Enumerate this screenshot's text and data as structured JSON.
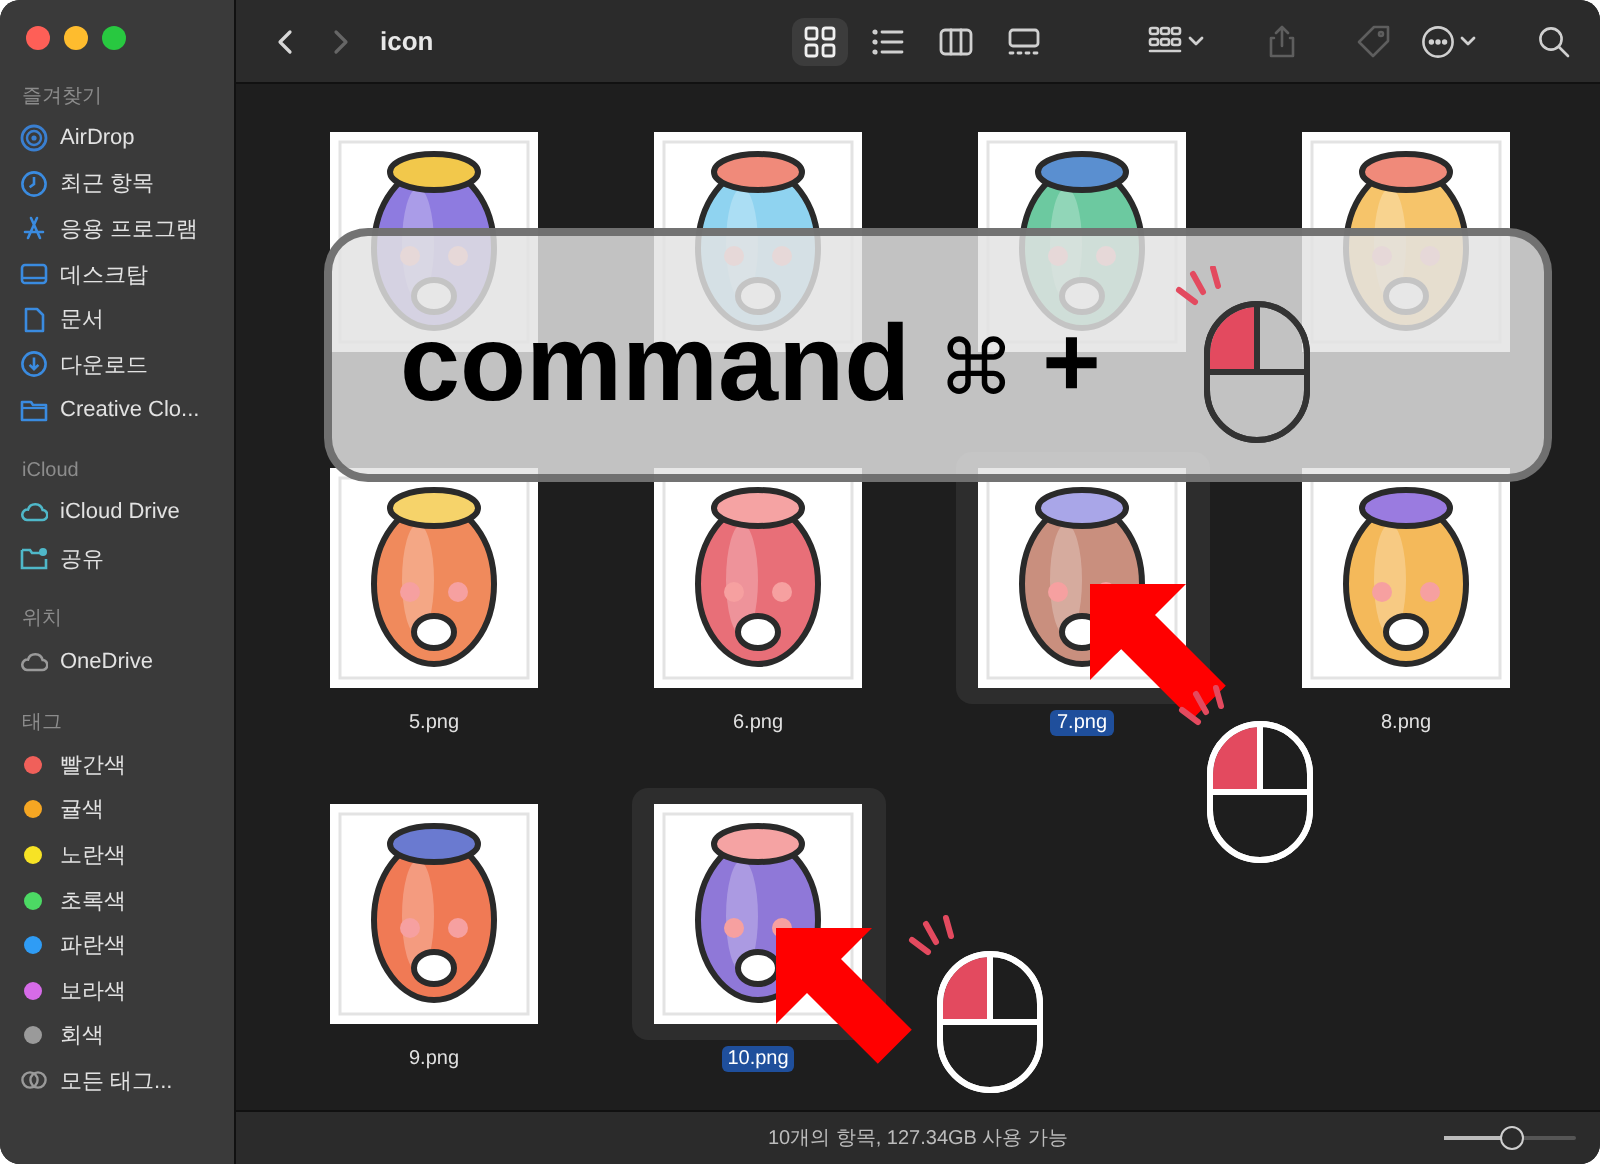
{
  "window": {
    "title": "icon"
  },
  "toolbar": {
    "nav": [
      {
        "kind": "back",
        "disabled": false
      },
      {
        "kind": "forward",
        "disabled": true
      }
    ],
    "view_modes": [
      {
        "kind": "icons",
        "selected": true
      },
      {
        "kind": "list",
        "selected": false
      },
      {
        "kind": "columns",
        "selected": false
      },
      {
        "kind": "gallery",
        "selected": false
      }
    ],
    "actions": [
      {
        "kind": "group",
        "disabled": false
      },
      {
        "kind": "share",
        "disabled": true
      },
      {
        "kind": "tag",
        "disabled": true
      },
      {
        "kind": "more",
        "disabled": false
      },
      {
        "kind": "search",
        "disabled": false
      }
    ]
  },
  "sidebar": {
    "sections": [
      {
        "title": "즐겨찾기",
        "items": [
          {
            "label": "AirDrop",
            "kind": "airdrop"
          },
          {
            "label": "최근 항목",
            "kind": "recents"
          },
          {
            "label": "응용 프로그램",
            "kind": "applications"
          },
          {
            "label": "데스크탑",
            "kind": "desktop"
          },
          {
            "label": "문서",
            "kind": "documents"
          },
          {
            "label": "다운로드",
            "kind": "downloads"
          },
          {
            "label": "Creative Clo...",
            "kind": "folder"
          }
        ]
      },
      {
        "title": "iCloud",
        "items": [
          {
            "label": "iCloud Drive",
            "kind": "icloud"
          },
          {
            "label": "공유",
            "kind": "shared"
          }
        ]
      },
      {
        "title": "위치",
        "items": [
          {
            "label": "OneDrive",
            "kind": "cloud"
          }
        ]
      },
      {
        "title": "태그",
        "items": [
          {
            "label": "빨간색",
            "kind": "tag",
            "color": "#f0605a"
          },
          {
            "label": "귤색",
            "kind": "tag",
            "color": "#f5a623"
          },
          {
            "label": "노란색",
            "kind": "tag",
            "color": "#f7e325"
          },
          {
            "label": "초록색",
            "kind": "tag",
            "color": "#4cd964"
          },
          {
            "label": "파란색",
            "kind": "tag",
            "color": "#2f9cf5"
          },
          {
            "label": "보라색",
            "kind": "tag",
            "color": "#d66be8"
          },
          {
            "label": "회색",
            "kind": "tag",
            "color": "#9a9a9a"
          },
          {
            "label": "모든 태그...",
            "kind": "all_tags"
          }
        ]
      }
    ]
  },
  "files": [
    {
      "selected": false
    },
    {
      "selected": false
    },
    {
      "selected": false
    },
    {
      "selected": false
    },
    {
      "label": "5.png",
      "selected": false
    },
    {
      "label": "6.png",
      "selected": false
    },
    {
      "label": "7.png",
      "selected": true
    },
    {
      "label": "8.png",
      "selected": false
    },
    {
      "label": "9.png",
      "selected": false
    },
    {
      "label": "10.png",
      "selected": true
    }
  ],
  "overlay": {
    "keys": [
      "command",
      "⌘",
      "+"
    ]
  },
  "status_bar": {
    "text": "10개의 항목, 127.34GB 사용 가능",
    "zoom": {
      "level": 0.52
    }
  }
}
